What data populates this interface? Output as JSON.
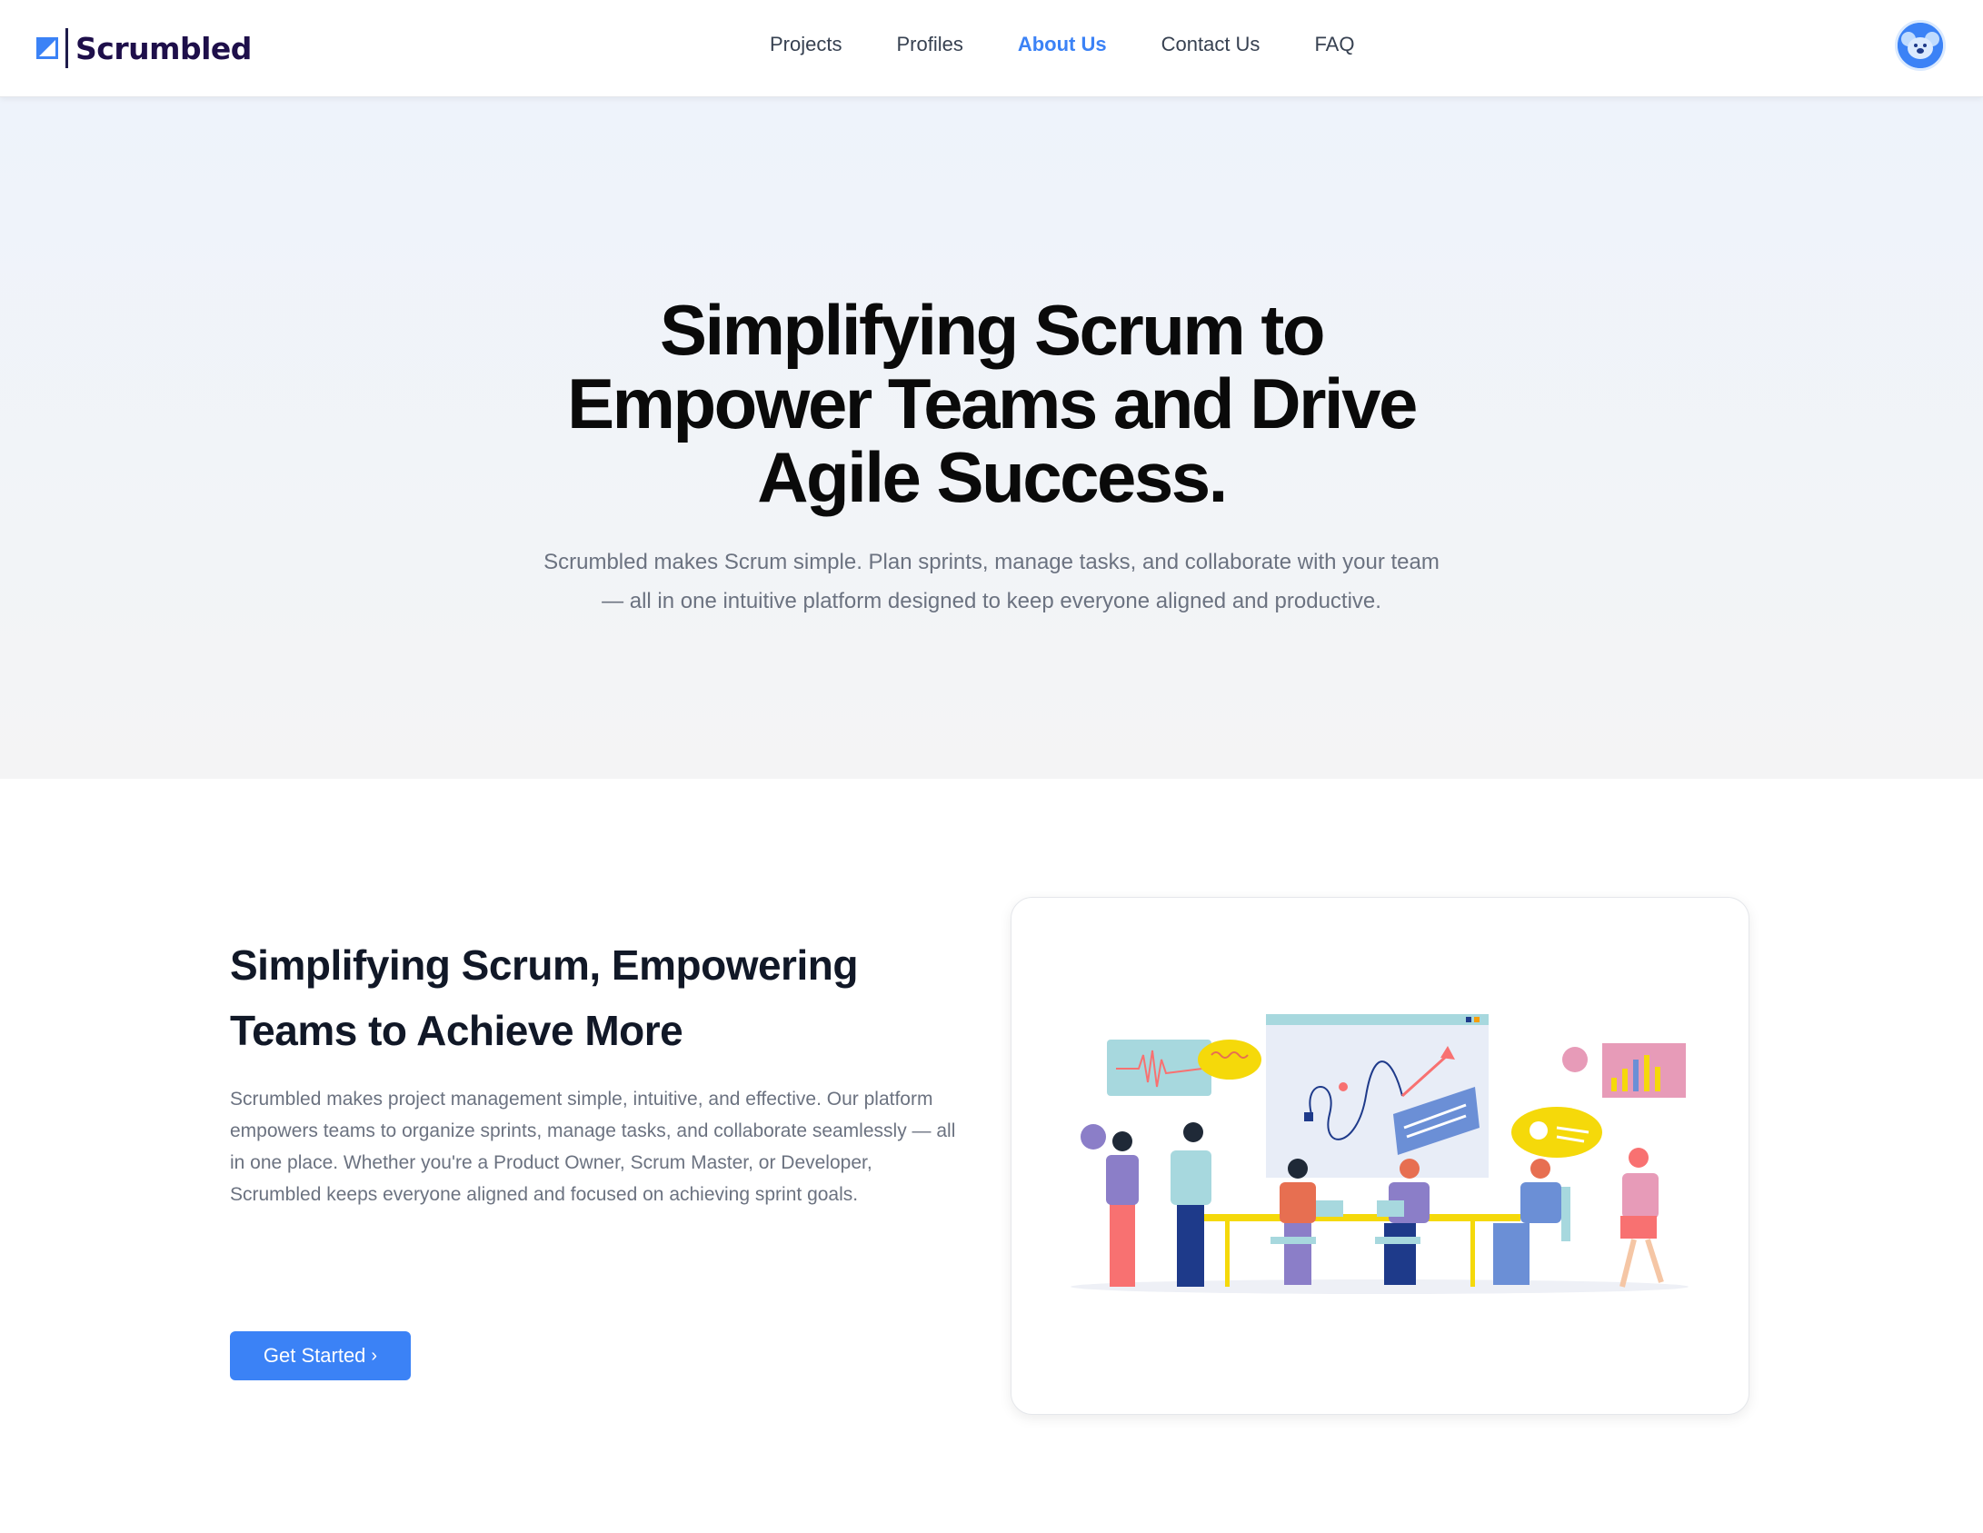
{
  "header": {
    "brand": "Scrumbled",
    "nav": [
      {
        "label": "Projects",
        "active": false
      },
      {
        "label": "Profiles",
        "active": false
      },
      {
        "label": "About Us",
        "active": true
      },
      {
        "label": "Contact Us",
        "active": false
      },
      {
        "label": "FAQ",
        "active": false
      }
    ],
    "avatar_icon": "koala-avatar-icon"
  },
  "hero": {
    "title_lines": [
      "Simplifying Scrum to",
      "Empower Teams and Drive",
      "Agile Success."
    ],
    "subtitle": "Scrumbled makes Scrum simple. Plan sprints, manage tasks, and collaborate with your team — all in one intuitive platform designed to keep everyone aligned and productive."
  },
  "feature": {
    "title_lines": [
      "Simplifying Scrum, Empowering",
      "Teams to Achieve More"
    ],
    "body": "Scrumbled makes project management simple, intuitive, and effective. Our platform empowers teams to organize sprints, manage tasks, and collaborate seamlessly — all in one place. Whether you're a Product Owner, Scrum Master, or Developer, Scrumbled keeps everyone aligned and focused on achieving sprint goals.",
    "cta_label": "Get Started",
    "cta_icon": "chevron-right-icon",
    "illustration": "team-meeting-illustration"
  },
  "colors": {
    "accent": "#3b82f6",
    "brand_text": "#1e0f4a",
    "heading": "#0a0a0a",
    "muted": "#6b7280"
  }
}
